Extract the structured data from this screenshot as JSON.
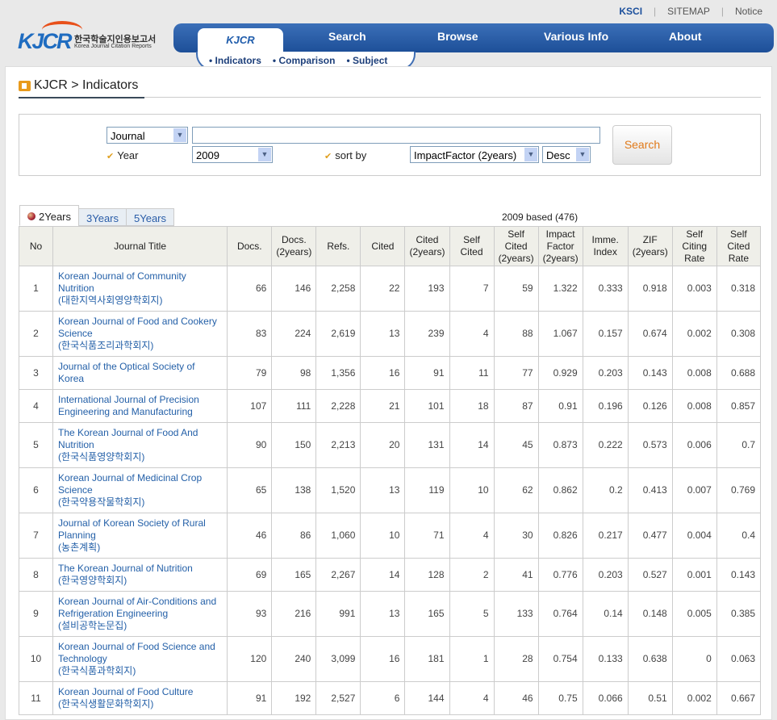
{
  "header": {
    "ksci": "KSCI",
    "sitemap": "SITEMAP",
    "notice": "Notice",
    "logo_text": "KJCR",
    "logo_ko": "한국학술지인용보고서",
    "logo_en": "Korea Journal Citation Reports",
    "nav": [
      "Search",
      "Browse",
      "Various Info",
      "About"
    ],
    "active_tab": "KJCR",
    "subnav": [
      "Indicators",
      "Comparison",
      "Subject"
    ]
  },
  "breadcrumb": "KJCR > Indicators",
  "search": {
    "field_type": "Journal",
    "query": "",
    "year_label": "Year",
    "year": "2009",
    "sort_label": "sort by",
    "sort_by": "ImpactFactor (2years)",
    "order": "Desc",
    "button": "Search"
  },
  "tabs": [
    "2Years",
    "3Years",
    "5Years"
  ],
  "based": "2009 based  (476)",
  "columns": [
    "No",
    "Journal Title",
    "Docs.",
    "Docs. (2years)",
    "Refs.",
    "Cited",
    "Cited (2years)",
    "Self Cited",
    "Self Cited (2years)",
    "Impact Factor (2years)",
    "Imme. Index",
    "ZIF (2years)",
    "Self Citing Rate",
    "Self Cited Rate"
  ],
  "rows": [
    {
      "no": "1",
      "title": "Korean Journal of Community Nutrition",
      "ko": "(대한지역사회영양학회지)",
      "v": [
        "66",
        "146",
        "2,258",
        "22",
        "193",
        "7",
        "59",
        "1.322",
        "0.333",
        "0.918",
        "0.003",
        "0.318"
      ]
    },
    {
      "no": "2",
      "title": "Korean Journal of Food and Cookery Science",
      "ko": "(한국식품조리과학회지)",
      "v": [
        "83",
        "224",
        "2,619",
        "13",
        "239",
        "4",
        "88",
        "1.067",
        "0.157",
        "0.674",
        "0.002",
        "0.308"
      ]
    },
    {
      "no": "3",
      "title": "Journal of the Optical Society of Korea",
      "ko": "",
      "v": [
        "79",
        "98",
        "1,356",
        "16",
        "91",
        "11",
        "77",
        "0.929",
        "0.203",
        "0.143",
        "0.008",
        "0.688"
      ]
    },
    {
      "no": "4",
      "title": "International Journal of Precision Engineering and Manufacturing",
      "ko": "",
      "v": [
        "107",
        "111",
        "2,228",
        "21",
        "101",
        "18",
        "87",
        "0.91",
        "0.196",
        "0.126",
        "0.008",
        "0.857"
      ]
    },
    {
      "no": "5",
      "title": "The Korean Journal of Food And Nutrition",
      "ko": "(한국식품영양학회지)",
      "v": [
        "90",
        "150",
        "2,213",
        "20",
        "131",
        "14",
        "45",
        "0.873",
        "0.222",
        "0.573",
        "0.006",
        "0.7"
      ]
    },
    {
      "no": "6",
      "title": "Korean Journal of Medicinal Crop Science",
      "ko": "(한국약용작물학회지)",
      "v": [
        "65",
        "138",
        "1,520",
        "13",
        "119",
        "10",
        "62",
        "0.862",
        "0.2",
        "0.413",
        "0.007",
        "0.769"
      ]
    },
    {
      "no": "7",
      "title": "Journal of Korean Society of Rural Planning",
      "ko": "(농촌계획)",
      "v": [
        "46",
        "86",
        "1,060",
        "10",
        "71",
        "4",
        "30",
        "0.826",
        "0.217",
        "0.477",
        "0.004",
        "0.4"
      ]
    },
    {
      "no": "8",
      "title": "The Korean Journal of Nutrition",
      "ko": "(한국영양학회지)",
      "v": [
        "69",
        "165",
        "2,267",
        "14",
        "128",
        "2",
        "41",
        "0.776",
        "0.203",
        "0.527",
        "0.001",
        "0.143"
      ]
    },
    {
      "no": "9",
      "title": "Korean Journal of Air-Conditions and Refrigeration Engineering",
      "ko": "(설비공학논문집)",
      "v": [
        "93",
        "216",
        "991",
        "13",
        "165",
        "5",
        "133",
        "0.764",
        "0.14",
        "0.148",
        "0.005",
        "0.385"
      ]
    },
    {
      "no": "10",
      "title": "Korean Journal of Food Science and Technology",
      "ko": "(한국식품과학회지)",
      "v": [
        "120",
        "240",
        "3,099",
        "16",
        "181",
        "1",
        "28",
        "0.754",
        "0.133",
        "0.638",
        "0",
        "0.063"
      ]
    },
    {
      "no": "11",
      "title": "Korean Journal of Food Culture",
      "ko": "(한국식생활문화학회지)",
      "v": [
        "91",
        "192",
        "2,527",
        "6",
        "144",
        "4",
        "46",
        "0.75",
        "0.066",
        "0.51",
        "0.002",
        "0.667"
      ]
    }
  ]
}
